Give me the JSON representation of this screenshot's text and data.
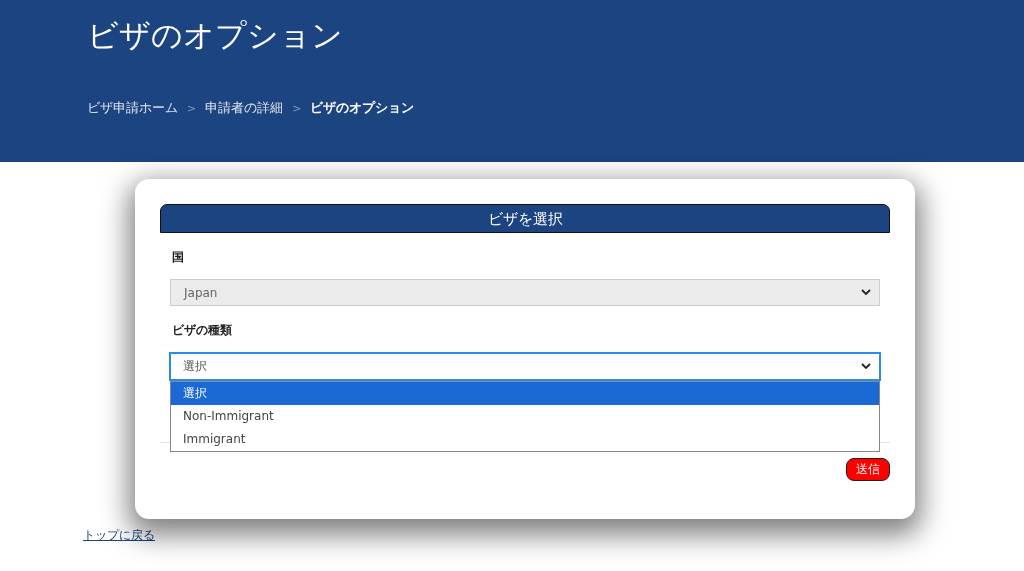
{
  "header": {
    "title": "ビザのオプション",
    "separator": ">",
    "breadcrumb": [
      {
        "label": "ビザ申請ホーム",
        "current": false
      },
      {
        "label": "申請者の詳細",
        "current": false
      },
      {
        "label": "ビザのオプション",
        "current": true
      }
    ]
  },
  "card": {
    "title": "ビザを選択",
    "fields": [
      {
        "label": "国",
        "value": "Japan",
        "disabled": true,
        "expanded": false
      },
      {
        "label": "ビザの種類",
        "value": "選択",
        "disabled": false,
        "expanded": true,
        "options": [
          {
            "label": "選択",
            "selected": true
          },
          {
            "label": "Non-Immigrant",
            "selected": false
          },
          {
            "label": "Immigrant",
            "selected": false
          }
        ]
      }
    ],
    "submit": "送信"
  },
  "back_link": "トップに戻る"
}
